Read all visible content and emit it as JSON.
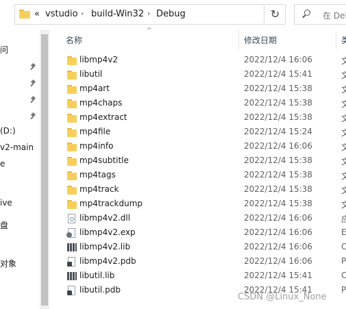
{
  "address": {
    "overflow": "«",
    "crumbs": [
      "vstudio",
      "build-Win32",
      "Debug"
    ],
    "dropdown_glyph": "⌄",
    "refresh_glyph": "↻"
  },
  "search": {
    "placeholder": "在 Debu"
  },
  "nav": {
    "items": [
      {
        "label": "问"
      },
      {
        "label": "(D:)"
      },
      {
        "label": "v2-main"
      },
      {
        "label": "e"
      },
      {
        "label": "ive"
      },
      {
        "label": "盘"
      },
      {
        "label": "对象"
      }
    ]
  },
  "columns": {
    "name": "名称",
    "date": "修改日期",
    "type": "类"
  },
  "files": [
    {
      "name": "libmp4v2",
      "date": "2022/12/4 16:06",
      "type": "文",
      "icon": "folder-icon"
    },
    {
      "name": "libutil",
      "date": "2022/12/4 15:41",
      "type": "文",
      "icon": "folder-icon"
    },
    {
      "name": "mp4art",
      "date": "2022/12/4 15:38",
      "type": "文",
      "icon": "folder-icon"
    },
    {
      "name": "mp4chaps",
      "date": "2022/12/4 15:38",
      "type": "文",
      "icon": "folder-icon"
    },
    {
      "name": "mp4extract",
      "date": "2022/12/4 15:38",
      "type": "文",
      "icon": "folder-icon"
    },
    {
      "name": "mp4file",
      "date": "2022/12/4 15:24",
      "type": "文",
      "icon": "folder-icon"
    },
    {
      "name": "mp4info",
      "date": "2022/12/4 16:06",
      "type": "文",
      "icon": "folder-icon"
    },
    {
      "name": "mp4subtitle",
      "date": "2022/12/4 15:38",
      "type": "文",
      "icon": "folder-icon"
    },
    {
      "name": "mp4tags",
      "date": "2022/12/4 15:38",
      "type": "文",
      "icon": "folder-icon"
    },
    {
      "name": "mp4track",
      "date": "2022/12/4 15:38",
      "type": "文",
      "icon": "folder-icon"
    },
    {
      "name": "mp4trackdump",
      "date": "2022/12/4 15:38",
      "type": "文",
      "icon": "folder-icon"
    },
    {
      "name": "libmp4v2.dll",
      "date": "2022/12/4 16:06",
      "type": "应",
      "icon": "dll-file-icon"
    },
    {
      "name": "libmp4v2.exp",
      "date": "2022/12/4 16:06",
      "type": "E",
      "icon": "exp-file-icon"
    },
    {
      "name": "libmp4v2.lib",
      "date": "2022/12/4 16:06",
      "type": "C",
      "icon": "lib-file-icon"
    },
    {
      "name": "libmp4v2.pdb",
      "date": "2022/12/4 16:06",
      "type": "P",
      "icon": "pdb-file-icon"
    },
    {
      "name": "libutil.lib",
      "date": "2022/12/4 15:41",
      "type": "C",
      "icon": "lib-file-icon"
    },
    {
      "name": "libutil.pdb",
      "date": "2022/12/4 15:41",
      "type": "P",
      "icon": "pdb-file-icon"
    }
  ],
  "watermark": "CSDN @Linux_None"
}
